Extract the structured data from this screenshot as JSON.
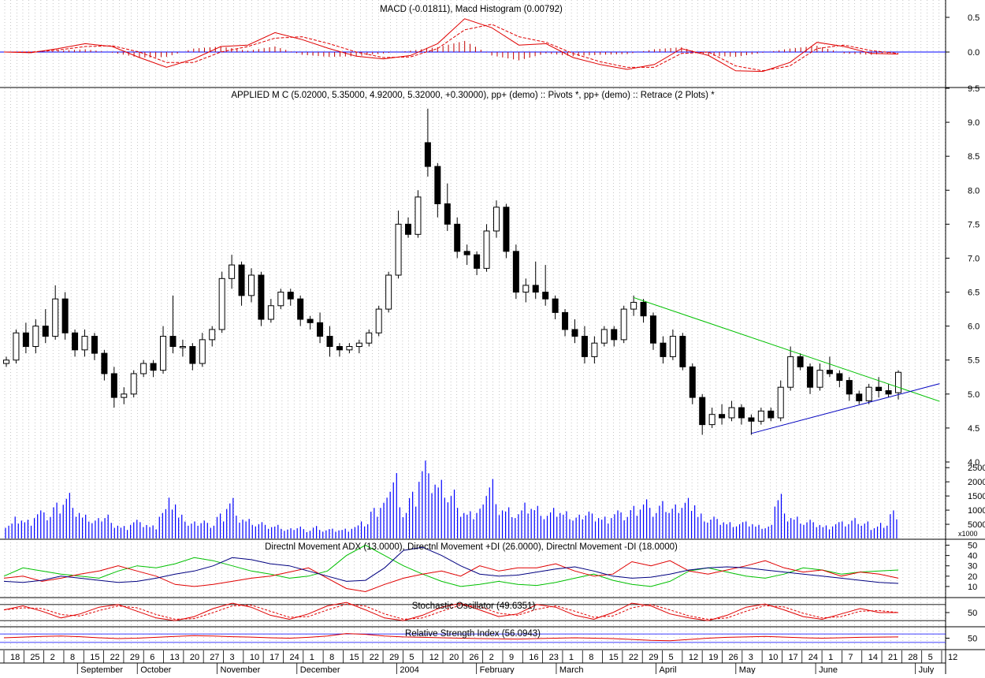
{
  "colors": {
    "background": "#ffffff",
    "up_candle": "#ffffff",
    "down_candle": "#000000",
    "wick": "#000000",
    "volume": "#0000ff",
    "zero_line": "#0000ff",
    "macd_hist": "#c00000",
    "macd_line": "#e00000",
    "macd_signal": "#e00000",
    "adx": "#000080",
    "plus_di": "#00c000",
    "minus_di": "#e00000",
    "stoch": "#e00000",
    "rsi": "#e00000",
    "trend_upper": "#00c000",
    "trend_lower": "#0000c0",
    "grid": "#a0a0a0"
  },
  "panels": {
    "macd_title": "MACD (-0.01811), Macd Histogram (0.00792)",
    "price_title": "APPLIED M C (5.02000, 5.35000, 4.92000, 5.32000, +0.30000), pp+ (demo) :: Pivots *, pp+ (demo) :: Retrace (2 Plots) *",
    "dmi_title": "Directnl Movement ADX (13.0000), Directnl Movement +DI (26.0000), Directnl Movement -DI (18.0000)",
    "stoch_title": "Stochastic Oscillator (49.6351)",
    "rsi_title": "Relative Strength Index (56.0943)",
    "volume_unit": "x1000"
  },
  "chart_data": [
    {
      "type": "line",
      "name": "macd",
      "yticks": [
        "0.5",
        "0.0"
      ],
      "ylim": [
        -0.5,
        0.75
      ],
      "macd": [
        0.0,
        -0.01,
        0.05,
        0.12,
        0.08,
        -0.08,
        -0.22,
        -0.1,
        0.08,
        0.1,
        0.28,
        0.18,
        0.05,
        -0.06,
        -0.1,
        -0.05,
        0.12,
        0.48,
        0.35,
        0.1,
        0.12,
        -0.08,
        -0.18,
        -0.25,
        -0.18,
        0.05,
        -0.05,
        -0.27,
        -0.28,
        -0.15,
        0.14,
        0.08,
        -0.02,
        -0.03
      ],
      "signal": [
        0.0,
        0.0,
        0.03,
        0.08,
        0.09,
        0.0,
        -0.15,
        -0.15,
        0.0,
        0.08,
        0.2,
        0.22,
        0.12,
        0.0,
        -0.08,
        -0.07,
        0.05,
        0.32,
        0.4,
        0.22,
        0.14,
        -0.02,
        -0.14,
        -0.22,
        -0.22,
        -0.02,
        0.0,
        -0.2,
        -0.27,
        -0.2,
        0.05,
        0.1,
        0.02,
        -0.02
      ],
      "hist": [
        0.0,
        -0.01,
        0.02,
        0.04,
        -0.01,
        -0.08,
        -0.07,
        0.05,
        0.08,
        0.02,
        0.08,
        -0.04,
        -0.07,
        -0.06,
        -0.02,
        0.02,
        0.07,
        0.16,
        -0.05,
        -0.12,
        -0.02,
        -0.06,
        -0.04,
        -0.03,
        0.04,
        0.07,
        -0.05,
        -0.07,
        -0.01,
        0.05,
        0.09,
        -0.02,
        -0.04,
        -0.01
      ]
    },
    {
      "type": "candlestick",
      "name": "price",
      "yticks": [
        "9.5",
        "9.0",
        "8.5",
        "8.0",
        "7.5",
        "7.0",
        "6.5",
        "6.0",
        "5.5",
        "5.0",
        "4.5",
        "4.0"
      ],
      "ylim": [
        4.0,
        9.5
      ],
      "candles": [
        [
          5.45,
          5.55,
          5.4,
          5.5
        ],
        [
          5.5,
          5.95,
          5.45,
          5.9
        ],
        [
          5.9,
          6.05,
          5.6,
          5.7
        ],
        [
          5.7,
          6.1,
          5.6,
          6.0
        ],
        [
          6.0,
          6.25,
          5.75,
          5.85
        ],
        [
          5.85,
          6.6,
          5.8,
          6.4
        ],
        [
          6.4,
          6.5,
          5.8,
          5.9
        ],
        [
          5.9,
          5.95,
          5.55,
          5.65
        ],
        [
          5.65,
          5.95,
          5.55,
          5.85
        ],
        [
          5.85,
          5.9,
          5.5,
          5.6
        ],
        [
          5.6,
          5.65,
          5.2,
          5.3
        ],
        [
          5.3,
          5.4,
          4.8,
          4.95
        ],
        [
          4.95,
          5.1,
          4.85,
          5.0
        ],
        [
          5.0,
          5.35,
          4.95,
          5.3
        ],
        [
          5.3,
          5.5,
          5.25,
          5.45
        ],
        [
          5.45,
          5.5,
          5.25,
          5.35
        ],
        [
          5.35,
          6.0,
          5.3,
          5.85
        ],
        [
          5.85,
          6.45,
          5.6,
          5.7
        ],
        [
          5.7,
          5.8,
          5.55,
          5.7
        ],
        [
          5.7,
          5.75,
          5.35,
          5.45
        ],
        [
          5.45,
          5.9,
          5.4,
          5.8
        ],
        [
          5.8,
          6.0,
          5.7,
          5.95
        ],
        [
          5.95,
          6.8,
          5.9,
          6.7
        ],
        [
          6.7,
          7.05,
          6.55,
          6.9
        ],
        [
          6.9,
          6.95,
          6.3,
          6.45
        ],
        [
          6.45,
          6.85,
          6.35,
          6.75
        ],
        [
          6.75,
          6.8,
          6.0,
          6.1
        ],
        [
          6.1,
          6.4,
          6.05,
          6.3
        ],
        [
          6.3,
          6.55,
          6.25,
          6.5
        ],
        [
          6.5,
          6.55,
          6.3,
          6.4
        ],
        [
          6.4,
          6.45,
          6.0,
          6.1
        ],
        [
          6.1,
          6.15,
          5.95,
          6.05
        ],
        [
          6.05,
          6.2,
          5.75,
          5.85
        ],
        [
          5.85,
          6.0,
          5.55,
          5.7
        ],
        [
          5.7,
          5.75,
          5.55,
          5.65
        ],
        [
          5.65,
          5.75,
          5.6,
          5.7
        ],
        [
          5.7,
          5.8,
          5.6,
          5.75
        ],
        [
          5.75,
          5.95,
          5.7,
          5.9
        ],
        [
          5.9,
          6.3,
          5.85,
          6.25
        ],
        [
          6.25,
          6.8,
          6.2,
          6.75
        ],
        [
          6.75,
          7.7,
          6.7,
          7.5
        ],
        [
          7.5,
          7.6,
          7.3,
          7.35
        ],
        [
          7.35,
          8.0,
          7.3,
          7.9
        ],
        [
          8.7,
          9.2,
          8.2,
          8.35
        ],
        [
          8.35,
          8.4,
          7.6,
          7.8
        ],
        [
          7.8,
          8.1,
          7.4,
          7.5
        ],
        [
          7.5,
          7.6,
          7.0,
          7.1
        ],
        [
          7.1,
          7.2,
          6.9,
          7.05
        ],
        [
          7.05,
          7.1,
          6.75,
          6.85
        ],
        [
          6.85,
          7.5,
          6.8,
          7.4
        ],
        [
          7.4,
          7.85,
          7.3,
          7.75
        ],
        [
          7.75,
          7.8,
          7.0,
          7.1
        ],
        [
          7.1,
          7.2,
          6.4,
          6.5
        ],
        [
          6.5,
          6.7,
          6.35,
          6.6
        ],
        [
          6.6,
          6.95,
          6.4,
          6.5
        ],
        [
          6.5,
          6.9,
          6.3,
          6.4
        ],
        [
          6.4,
          6.45,
          6.1,
          6.2
        ],
        [
          6.2,
          6.25,
          5.85,
          5.95
        ],
        [
          5.95,
          6.1,
          5.75,
          5.85
        ],
        [
          5.85,
          6.0,
          5.45,
          5.55
        ],
        [
          5.55,
          5.85,
          5.45,
          5.75
        ],
        [
          5.75,
          6.0,
          5.7,
          5.95
        ],
        [
          5.95,
          6.0,
          5.7,
          5.8
        ],
        [
          5.8,
          6.3,
          5.75,
          6.25
        ],
        [
          6.25,
          6.45,
          6.15,
          6.35
        ],
        [
          6.35,
          6.4,
          6.05,
          6.15
        ],
        [
          6.15,
          6.2,
          5.65,
          5.75
        ],
        [
          5.75,
          5.85,
          5.45,
          5.55
        ],
        [
          5.55,
          5.95,
          5.5,
          5.85
        ],
        [
          5.85,
          5.9,
          5.35,
          5.4
        ],
        [
          5.4,
          5.45,
          4.85,
          4.95
        ],
        [
          4.95,
          5.0,
          4.4,
          4.55
        ],
        [
          4.55,
          4.8,
          4.5,
          4.7
        ],
        [
          4.7,
          4.85,
          4.55,
          4.65
        ],
        [
          4.65,
          4.9,
          4.6,
          4.8
        ],
        [
          4.8,
          4.85,
          4.55,
          4.65
        ],
        [
          4.65,
          4.7,
          4.4,
          4.6
        ],
        [
          4.6,
          4.8,
          4.55,
          4.75
        ],
        [
          4.75,
          4.8,
          4.6,
          4.65
        ],
        [
          4.65,
          5.2,
          4.6,
          5.1
        ],
        [
          5.1,
          5.7,
          5.05,
          5.55
        ],
        [
          5.55,
          5.6,
          5.35,
          5.4
        ],
        [
          5.4,
          5.45,
          5.0,
          5.1
        ],
        [
          5.1,
          5.45,
          5.05,
          5.35
        ],
        [
          5.35,
          5.55,
          5.25,
          5.3
        ],
        [
          5.3,
          5.35,
          5.1,
          5.2
        ],
        [
          5.2,
          5.25,
          4.9,
          5.0
        ],
        [
          5.0,
          5.05,
          4.85,
          4.9
        ],
        [
          4.9,
          5.15,
          4.85,
          5.1
        ],
        [
          5.1,
          5.25,
          4.95,
          5.05
        ],
        [
          5.05,
          5.15,
          4.95,
          5.0
        ],
        [
          5.02,
          5.35,
          4.92,
          5.32
        ]
      ],
      "trendlines": [
        {
          "role": "upper",
          "from": [
            64,
            6.42
          ],
          "to": [
            92,
            5.05
          ]
        },
        {
          "role": "lower",
          "from": [
            76,
            4.42
          ],
          "to": [
            92,
            5.03
          ]
        }
      ]
    },
    {
      "type": "bar",
      "name": "volume",
      "yticks": [
        "25000",
        "20000",
        "15000",
        "10000",
        "5000"
      ],
      "ylim": [
        0,
        27000
      ],
      "values": [
        5000,
        7000,
        6000,
        9000,
        8000,
        11000,
        14000,
        9000,
        7000,
        6000,
        8000,
        5000,
        4000,
        6000,
        5000,
        4000,
        9000,
        12000,
        7000,
        5000,
        6000,
        5000,
        8000,
        13000,
        7000,
        6000,
        5000,
        4000,
        4000,
        3000,
        4000,
        3000,
        4000,
        3000,
        3000,
        3000,
        4000,
        5000,
        9000,
        12000,
        22000,
        10000,
        15000,
        25000,
        20000,
        18000,
        15000,
        9000,
        8000,
        10000,
        20000,
        11000,
        10000,
        9000,
        11000,
        10000,
        8000,
        9000,
        8000,
        7000,
        9000,
        8000,
        7000,
        9000,
        8000,
        10000,
        12000,
        9000,
        11000,
        10000,
        12000,
        13000,
        8000,
        7000,
        6000,
        5000,
        5000,
        5000,
        4000,
        4000,
        15000,
        8000,
        7000,
        6000,
        5000,
        4000,
        5000,
        5000,
        6000,
        5000,
        4000,
        5000,
        9000
      ],
      "x_labels": [
        "18",
        "25",
        "2",
        "8",
        "15",
        "22",
        "29",
        "6",
        "13",
        "20",
        "27",
        "3",
        "10",
        "17",
        "24",
        "1",
        "8",
        "15",
        "22",
        "29",
        "5",
        "12",
        "20",
        "26",
        "2",
        "9",
        "16",
        "23",
        "1",
        "8",
        "15",
        "22",
        "29",
        "5",
        "12",
        "19",
        "26",
        "3",
        "10",
        "17",
        "24",
        "1",
        "7",
        "14",
        "21",
        "28",
        "5",
        "12"
      ],
      "months": [
        "September",
        "October",
        "November",
        "December",
        "2004",
        "February",
        "March",
        "April",
        "May",
        "June",
        "July"
      ]
    },
    {
      "type": "line",
      "name": "dmi",
      "yticks": [
        "50",
        "40",
        "30",
        "20",
        "10"
      ],
      "ylim": [
        0,
        55
      ],
      "adx": [
        15,
        14,
        16,
        20,
        18,
        16,
        14,
        15,
        18,
        22,
        25,
        30,
        38,
        36,
        32,
        30,
        25,
        20,
        15,
        16,
        28,
        45,
        48,
        40,
        30,
        22,
        20,
        21,
        24,
        27,
        29,
        25,
        20,
        18,
        19,
        22,
        26,
        28,
        29,
        28,
        26,
        24,
        22,
        20,
        18,
        16,
        14,
        13
      ],
      "plus_di": [
        20,
        28,
        25,
        22,
        20,
        18,
        25,
        30,
        28,
        32,
        38,
        35,
        30,
        25,
        22,
        18,
        20,
        25,
        40,
        50,
        40,
        30,
        22,
        15,
        10,
        12,
        15,
        12,
        11,
        14,
        18,
        22,
        16,
        12,
        10,
        15,
        25,
        28,
        24,
        20,
        18,
        22,
        28,
        26,
        22,
        24,
        25,
        26
      ],
      "minus_di": [
        18,
        20,
        15,
        18,
        22,
        25,
        30,
        25,
        20,
        12,
        10,
        12,
        15,
        18,
        20,
        24,
        28,
        18,
        8,
        5,
        12,
        18,
        22,
        25,
        20,
        30,
        25,
        28,
        28,
        32,
        25,
        20,
        22,
        34,
        30,
        35,
        25,
        22,
        26,
        30,
        35,
        28,
        24,
        26,
        20,
        24,
        22,
        18
      ]
    },
    {
      "type": "line",
      "name": "stochastic",
      "yticks": [
        "50"
      ],
      "ylim": [
        0,
        100
      ],
      "values": [
        60,
        75,
        55,
        30,
        45,
        70,
        80,
        55,
        30,
        20,
        35,
        65,
        85,
        70,
        40,
        25,
        45,
        75,
        88,
        60,
        30,
        20,
        40,
        70,
        85,
        60,
        35,
        45,
        80,
        70,
        40,
        25,
        50,
        85,
        75,
        45,
        30,
        20,
        40,
        70,
        82,
        60,
        35,
        25,
        45,
        65,
        50,
        50
      ]
    },
    {
      "type": "line",
      "name": "rsi",
      "yticks": [
        "50"
      ],
      "ylim": [
        0,
        100
      ],
      "values": [
        52,
        55,
        58,
        60,
        57,
        52,
        48,
        50,
        54,
        58,
        62,
        60,
        57,
        55,
        52,
        50,
        54,
        60,
        72,
        68,
        60,
        56,
        54,
        52,
        50,
        48,
        47,
        46,
        48,
        50,
        52,
        50,
        48,
        44,
        40,
        38,
        44,
        50,
        54,
        56,
        58,
        55,
        52,
        50,
        52,
        54,
        55,
        56
      ]
    }
  ]
}
